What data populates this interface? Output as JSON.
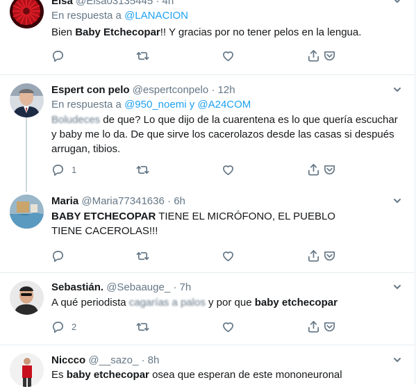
{
  "tweets": [
    {
      "name": "Elsa",
      "handle": "@Elsa03135445",
      "dot": "·",
      "time": "4h",
      "reply_prefix": "En respuesta a",
      "reply_to": "@LANACION",
      "text_parts": [
        "Bien ",
        "Baby Etchecopar",
        "!! Y gracias por no tener pelos en la lengua."
      ],
      "reply_count": "",
      "retweet_count": "",
      "like_count": ""
    },
    {
      "name": "Espert con pelo",
      "handle": "@espertconpelo",
      "dot": "·",
      "time": "12h",
      "reply_prefix": "En respuesta a",
      "reply_to": "@950_noemi",
      "reply_joiner": "y",
      "reply_to_2": "@A24COM",
      "text_blurred": "Boludeces",
      "text": " de que? Lo que dijo de la cuarentena es lo que quería escuchar y baby me lo da. De que sirve los cacerolazos desde las casas si después arrugan, tibios.",
      "reply_count": "1",
      "retweet_count": "",
      "like_count": ""
    },
    {
      "name": "Maria",
      "handle": "@Maria77341636",
      "dot": "·",
      "time": "6h",
      "text_parts": [
        "BABY ETCHECOPAR",
        " TIENE EL MICRÓFONO, EL PUEBLO TIENE CACEROLAS!!!"
      ],
      "reply_count": "",
      "retweet_count": "",
      "like_count": ""
    },
    {
      "name": "Sebastián.",
      "handle": "@Sebaauge_",
      "dot": "·",
      "time": "7h",
      "text_parts": [
        "A qué periodista ",
        "cagarías a palos",
        " y por que ",
        "baby etchecopar"
      ],
      "reply_count": "2",
      "retweet_count": "",
      "like_count": ""
    },
    {
      "name": "Niccco",
      "handle": "@__sazo_",
      "dot": "·",
      "time": "8h",
      "text_parts": [
        "Es ",
        "baby etchecopar",
        " osea que esperan de este mononeuronal"
      ]
    }
  ],
  "icons": {
    "reply": "reply-icon",
    "retweet": "retweet-icon",
    "like": "heart-icon",
    "share": "share-icon",
    "more": "chevron-down-icon"
  },
  "colors": {
    "link": "#1da1f2",
    "secondary": "#657786",
    "border": "#e6ecf0"
  }
}
